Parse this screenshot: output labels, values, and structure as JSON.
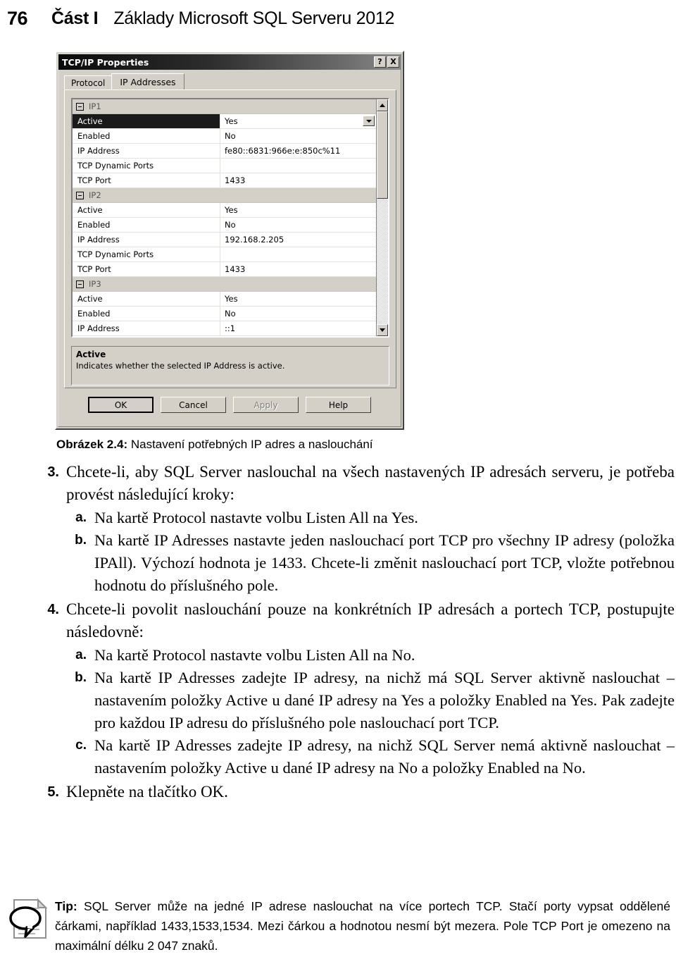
{
  "page": {
    "number": "76",
    "part_label": "Část I",
    "book_title": "Základy Microsoft SQL Serveru 2012"
  },
  "dialog": {
    "title": "TCP/IP Properties",
    "help_button": "?",
    "close_button": "X",
    "tabs": [
      {
        "label": "Protocol",
        "active": false
      },
      {
        "label": "IP Addresses",
        "active": true
      }
    ],
    "grid": [
      {
        "kind": "group",
        "label": "IP1"
      },
      {
        "kind": "row",
        "name": "Active",
        "value": "Yes",
        "selected": true,
        "combo": true
      },
      {
        "kind": "row",
        "name": "Enabled",
        "value": "No"
      },
      {
        "kind": "row",
        "name": "IP Address",
        "value": "fe80::6831:966e:e:850c%11"
      },
      {
        "kind": "row",
        "name": "TCP Dynamic Ports",
        "value": ""
      },
      {
        "kind": "row",
        "name": "TCP Port",
        "value": "1433"
      },
      {
        "kind": "group",
        "label": "IP2"
      },
      {
        "kind": "row",
        "name": "Active",
        "value": "Yes"
      },
      {
        "kind": "row",
        "name": "Enabled",
        "value": "No"
      },
      {
        "kind": "row",
        "name": "IP Address",
        "value": "192.168.2.205"
      },
      {
        "kind": "row",
        "name": "TCP Dynamic Ports",
        "value": ""
      },
      {
        "kind": "row",
        "name": "TCP Port",
        "value": "1433"
      },
      {
        "kind": "group",
        "label": "IP3"
      },
      {
        "kind": "row",
        "name": "Active",
        "value": "Yes"
      },
      {
        "kind": "row",
        "name": "Enabled",
        "value": "No"
      },
      {
        "kind": "row",
        "name": "IP Address",
        "value": "::1"
      }
    ],
    "description": {
      "title": "Active",
      "text": "Indicates whether the selected IP Address is active."
    },
    "buttons": [
      {
        "label": "OK",
        "style": "default"
      },
      {
        "label": "Cancel",
        "style": "normal"
      },
      {
        "label": "Apply",
        "style": "disabled"
      },
      {
        "label": "Help",
        "style": "normal"
      }
    ]
  },
  "figure": {
    "label": "Obrázek 2.4:",
    "caption": "Nastavení potřebných IP adres a naslouchání"
  },
  "steps": [
    {
      "marker": "3.",
      "text": "Chcete-li, aby SQL Server naslouchal na všech nastavených IP adresách serveru, je potřeba provést následující kroky:",
      "sub": [
        {
          "marker": "a.",
          "text": "Na kartě Protocol nastavte volbu Listen All na Yes."
        },
        {
          "marker": "b.",
          "text": "Na kartě IP Adresses nastavte jeden naslouchací port TCP pro všechny IP adresy (položka IPAll). Výchozí hodnota je 1433. Chcete-li změnit naslouchací port TCP, vložte potřebnou hodnotu do příslušného pole."
        }
      ]
    },
    {
      "marker": "4.",
      "text": "Chcete-li povolit naslouchání pouze na konkrétních IP adresách a portech TCP, postupujte následovně:",
      "sub": [
        {
          "marker": "a.",
          "text": "Na kartě Protocol nastavte volbu Listen All na No."
        },
        {
          "marker": "b.",
          "text": "Na kartě IP Adresses zadejte IP adresy, na nichž má SQL Server aktivně naslouchat – nastavením položky Active u dané IP adresy na Yes a položky Enabled na Yes. Pak zadejte pro každou IP adresu do příslušného pole naslouchací port TCP."
        },
        {
          "marker": "c.",
          "text": "Na kartě IP Adresses zadejte IP adresy, na nichž SQL Server nemá aktivně naslouchat – nastavením položky Active u dané IP adresy na No a položky Enabled na No."
        }
      ]
    },
    {
      "marker": "5.",
      "text": "Klepněte na tlačítko OK.",
      "sub": []
    }
  ],
  "tip": {
    "label": "Tip:",
    "text": "SQL Server může na jedné IP adrese naslouchat na více portech TCP. Stačí porty vypsat oddělené čárkami, například 1433,1533,1534. Mezi čárkou a hodnotou nesmí být mezera. Pole TCP Port je omezeno na maximální délku 2 047 znaků."
  }
}
